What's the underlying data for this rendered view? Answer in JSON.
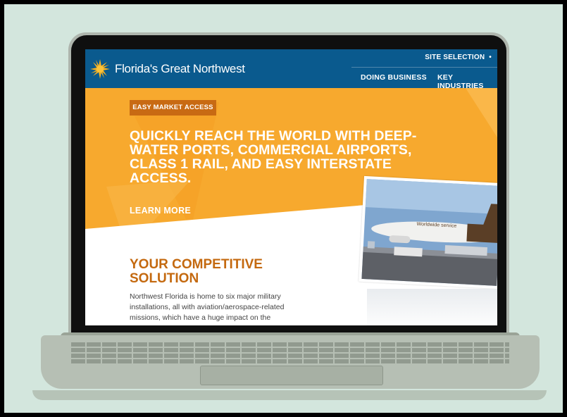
{
  "site": {
    "logo_text": "Florida's Great Northwest",
    "top_link": "SITE SELECTION",
    "top_link_dot": "•",
    "nav": [
      {
        "label": "DOING BUSINESS"
      },
      {
        "label": "KEY INDUSTRIES"
      }
    ]
  },
  "hero": {
    "badge": "EASY MARKET ACCESS",
    "headline": "QUICKLY REACH THE WORLD WITH DEEP-WATER PORTS, COMMERCIAL AIRPORTS, CLASS 1 RAIL, AND EASY INTERSTATE ACCESS.",
    "cta": "LEARN MORE",
    "photo_caption": "Worldwide service"
  },
  "section": {
    "title": "YOUR COMPETITIVE SOLUTION",
    "body": "Northwest Florida is home to six major military installations, all with aviation/aerospace-related missions, which have a huge impact on the"
  },
  "colors": {
    "header_blue": "#0a5a8e",
    "hero_orange": "#f7a92e",
    "badge_orange": "#c86a13",
    "title_orange": "#c4690f",
    "background_mint": "#d3e6dd"
  }
}
